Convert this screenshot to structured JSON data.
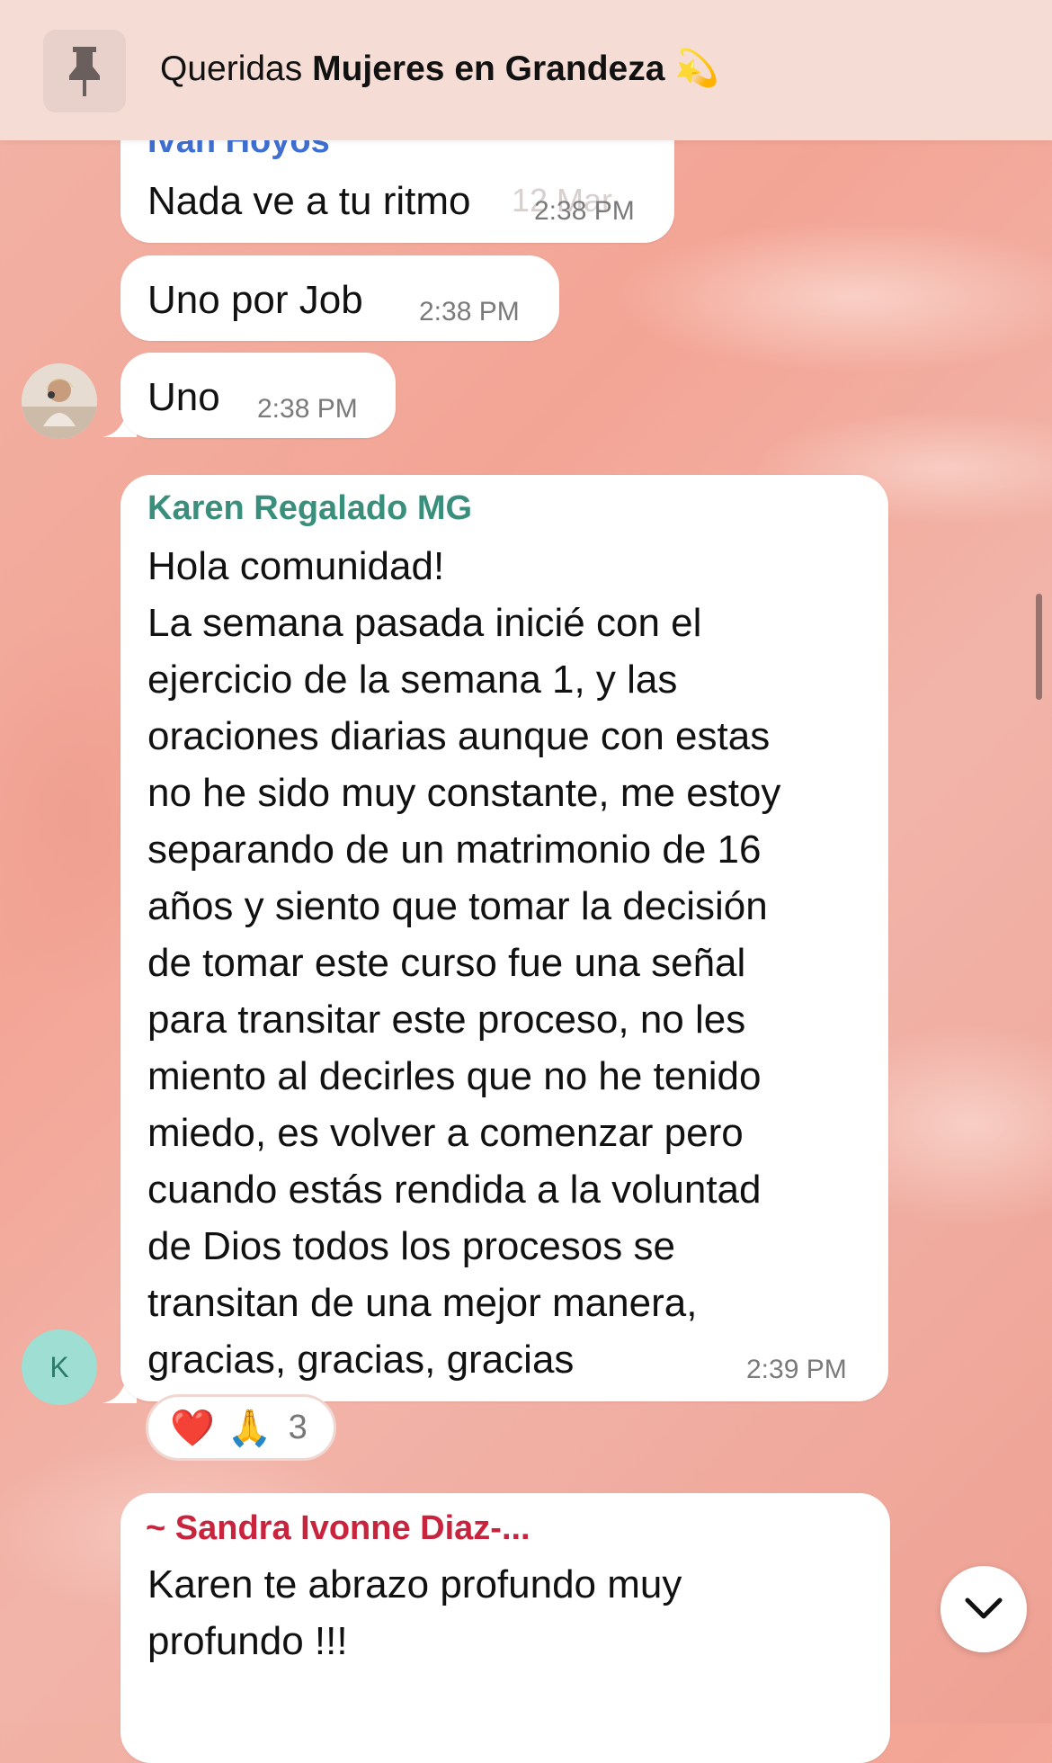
{
  "pinned": {
    "prefix": "Queridas ",
    "title_bold": "Mujeres en Grandeza",
    "emoji": "💫"
  },
  "messages": [
    {
      "sender": "Ivan Hoyos",
      "text": "Nada ve a tu ritmo",
      "time": "2:38 PM",
      "ghost_date": "12 Mar"
    },
    {
      "text": "Uno por Job",
      "time": "2:38 PM"
    },
    {
      "text": "Uno",
      "time": "2:38 PM"
    },
    {
      "sender": "Karen Regalado MG",
      "lines": [
        "Hola comunidad!",
        "La semana pasada inicié con el",
        "ejercicio de la semana 1, y las",
        "oraciones diarias aunque con estas",
        "no he sido muy constante, me estoy",
        "separando de un matrimonio de 16",
        "años y siento que tomar la decisión",
        "de tomar este curso fue una señal",
        "para transitar este proceso, no les",
        "miento al decirles que no he tenido",
        "miedo, es volver a comenzar pero",
        "cuando estás rendida a la voluntad",
        "de Dios todos los procesos se",
        "transitan de una mejor manera,",
        "gracias, gracias, gracias"
      ],
      "time": "2:39 PM",
      "avatar_initial": "K",
      "reactions": {
        "heart": "❤️",
        "pray": "🙏",
        "count": "3"
      }
    },
    {
      "sender": "~ Sandra Ivonne Diaz-...",
      "lines": [
        "Karen te abrazo profundo muy",
        "profundo !!!"
      ]
    }
  ],
  "colors": {
    "ivan": "#3f6fd1",
    "karen": "#3a8f7c",
    "sandra": "#c8243e",
    "avatar_k_bg": "#9fded3",
    "avatar_k_fg": "#2f7a6c"
  }
}
